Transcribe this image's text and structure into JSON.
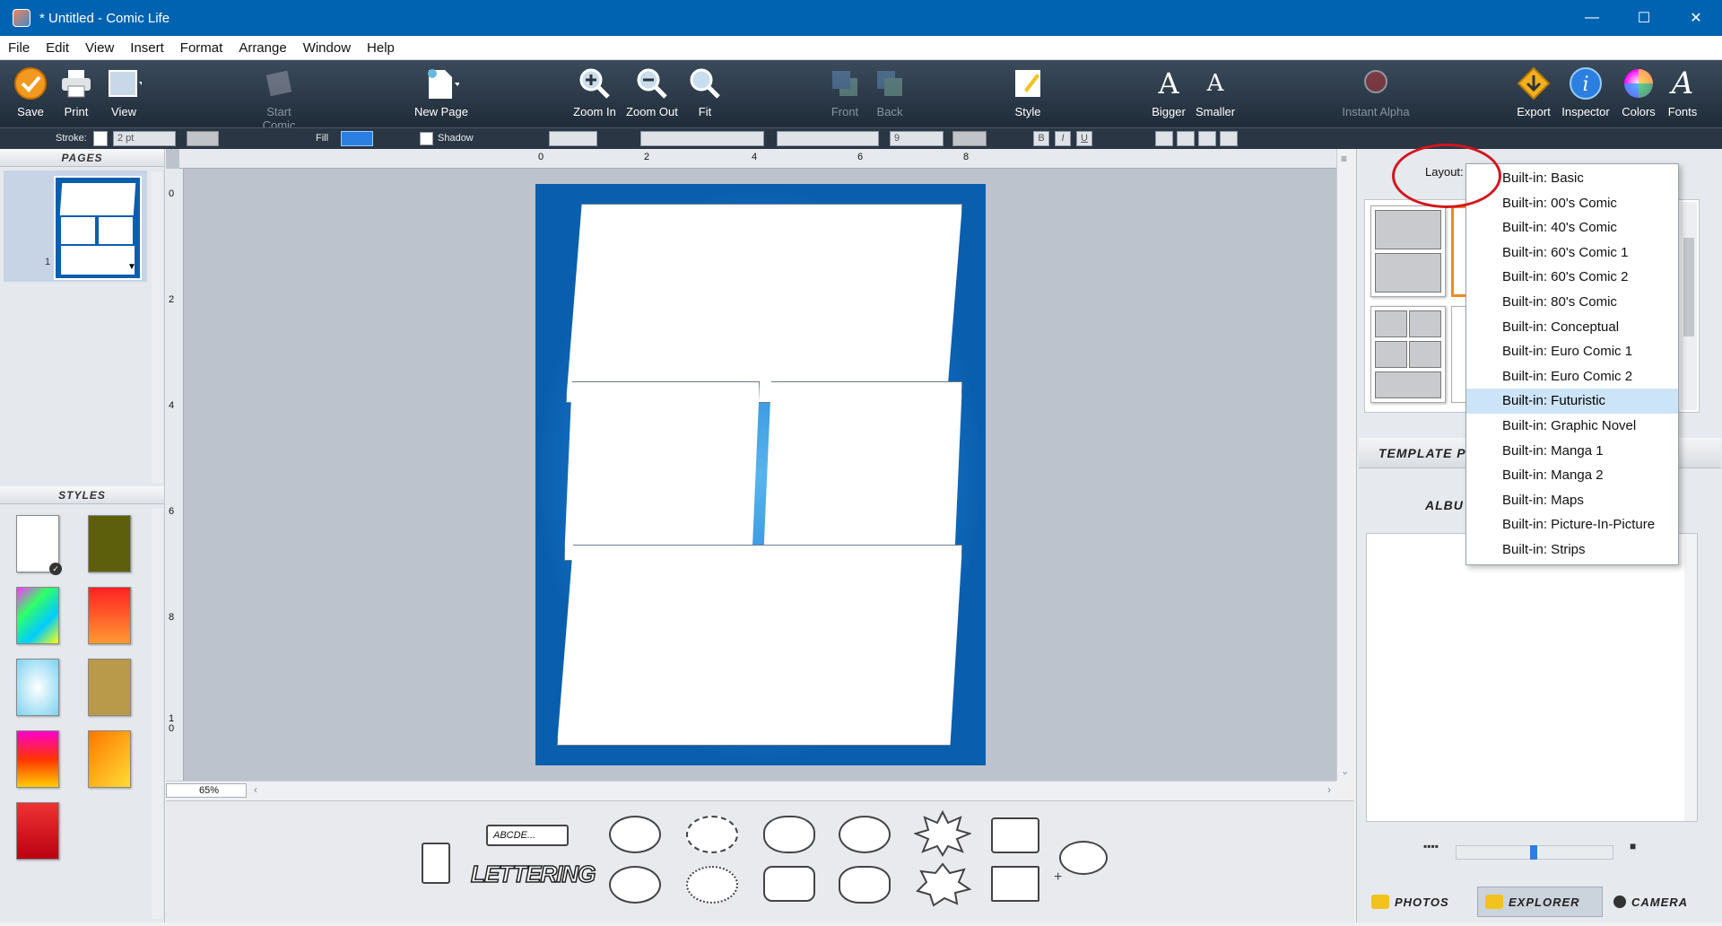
{
  "window": {
    "title": "* Untitled - Comic Life",
    "minimize": "—",
    "maximize": "☐",
    "close": "✕"
  },
  "menu": [
    "File",
    "Edit",
    "View",
    "Insert",
    "Format",
    "Arrange",
    "Window",
    "Help"
  ],
  "toolbar": {
    "save": "Save",
    "print": "Print",
    "view": "View",
    "start_comic": "Start Comic",
    "new_page": "New Page",
    "zoom_in": "Zoom In",
    "zoom_out": "Zoom Out",
    "fit": "Fit",
    "front": "Front",
    "back": "Back",
    "style": "Style",
    "bigger": "Bigger",
    "smaller": "Smaller",
    "instant_alpha": "Instant Alpha",
    "export": "Export",
    "inspector": "Inspector",
    "colors": "Colors",
    "fonts": "Fonts"
  },
  "formatbar": {
    "stroke_label": "Stroke:",
    "stroke_value": "2 pt",
    "fill_label": "Fill",
    "shadow_label": "Shadow",
    "font_size": "9",
    "bold": "B",
    "italic": "I",
    "underline": "U"
  },
  "pages_panel": {
    "header": "PAGES",
    "page_number": "1"
  },
  "styles_panel": {
    "header": "STYLES"
  },
  "canvas": {
    "zoom": "65%",
    "ruler_top": [
      "0",
      "2",
      "4",
      "6",
      "8"
    ],
    "ruler_left": [
      "0",
      "2",
      "4",
      "6",
      "8",
      "1\n0"
    ]
  },
  "elements": {
    "caption_label": "ABCDE...",
    "lettering": "LETTERING"
  },
  "right_panel": {
    "layout_label": "Layout:",
    "template_tab": "TEMPLATE P",
    "album_tab": "ALBU",
    "bottom_tabs": {
      "photos": "PHOTOS",
      "explorer": "EXPLORER",
      "camera": "CAMERA"
    }
  },
  "layout_dropdown": {
    "selected": "Built-in: Futuristic",
    "items": [
      "Built-in: Basic",
      "Built-in: 00's Comic",
      "Built-in: 40's Comic",
      "Built-in: 60's Comic 1",
      "Built-in: 60's Comic 2",
      "Built-in: 80's Comic",
      "Built-in: Conceptual",
      "Built-in: Euro Comic 1",
      "Built-in: Euro Comic 2",
      "Built-in: Futuristic",
      "Built-in: Graphic Novel",
      "Built-in: Manga 1",
      "Built-in: Manga 2",
      "Built-in: Maps",
      "Built-in: Picture-In-Picture",
      "Built-in: Strips"
    ]
  },
  "colors": {
    "titlebar": "#0063b1",
    "page_bg": "#0a5eae",
    "highlight": "#cce4f7",
    "annotation": "#d4151d"
  }
}
